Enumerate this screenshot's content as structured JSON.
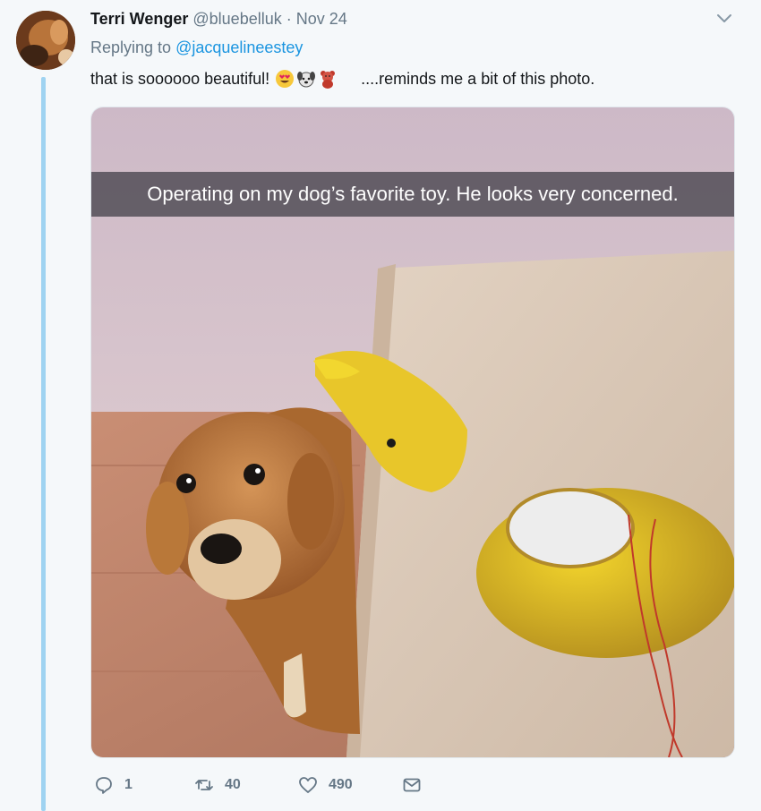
{
  "tweet": {
    "author_name": "Terri Wenger",
    "handle": "@bluebelluk",
    "separator": "·",
    "date": "Nov 24",
    "replying_prefix": "Replying to ",
    "replying_to": "@jacquelineestey",
    "text_before": "that is soooooo beautiful!",
    "emojis": [
      "heart-eyes-emoji",
      "dog-face-emoji",
      "teddy-bear-emoji"
    ],
    "text_after": "....reminds me a bit of this photo."
  },
  "media": {
    "caption": "Operating on my dog’s favorite toy. He looks very concerned."
  },
  "actions": {
    "reply_count": "1",
    "retweet_count": "40",
    "like_count": "490"
  },
  "colors": {
    "link": "#1b95e0",
    "muted": "#657786",
    "thread_line": "#9fd3f1",
    "background": "#f5f8fa"
  }
}
